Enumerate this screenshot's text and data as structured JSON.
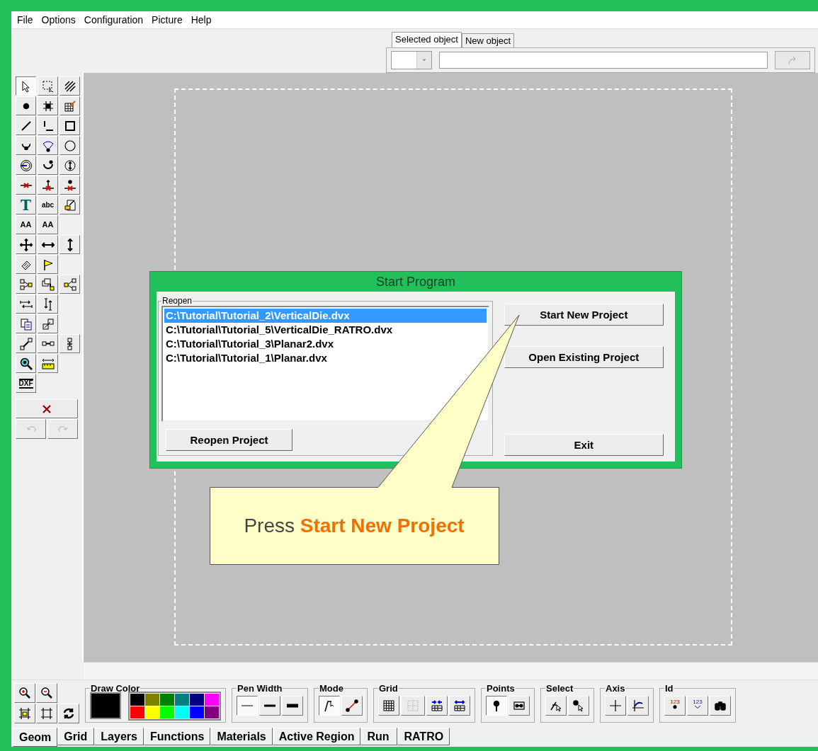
{
  "menu": [
    "File",
    "Options",
    "Configuration",
    "Picture",
    "Help"
  ],
  "object_tabs": [
    {
      "label": "Selected object",
      "selected": true
    },
    {
      "label": "New object",
      "selected": false
    }
  ],
  "palette_rows": [
    {
      "tools": [
        {
          "selected": true
        },
        {
          "selected": false
        },
        {
          "selected": false
        }
      ]
    },
    {
      "tools": [
        {
          "selected": false
        },
        {
          "selected": false
        },
        {
          "selected": false
        }
      ]
    },
    {
      "tools": [
        {
          "selected": false
        },
        {
          "selected": false
        },
        {
          "selected": false
        }
      ]
    },
    {
      "tools": [
        {
          "selected": false
        },
        {
          "selected": false
        },
        {
          "selected": false
        }
      ]
    },
    {
      "tools": [
        {
          "selected": false
        },
        {
          "selected": false
        },
        {
          "selected": false
        }
      ]
    },
    {
      "tools": [
        {
          "selected": false
        },
        {
          "selected": false
        },
        {
          "selected": false
        }
      ]
    },
    {
      "tools": [
        {
          "selected": false,
          "label": "T"
        },
        {
          "selected": false,
          "label": "abc"
        },
        {
          "selected": false
        }
      ]
    },
    {
      "tools": [
        {
          "selected": false,
          "label": "AA"
        },
        {
          "selected": false,
          "label": "AA"
        }
      ]
    },
    {
      "tools": [
        {
          "selected": false
        },
        {
          "selected": false
        },
        {
          "selected": false
        }
      ]
    },
    {
      "tools": [
        {
          "selected": false
        },
        {
          "selected": false
        }
      ]
    },
    {
      "tools": [
        {
          "selected": false
        },
        {
          "selected": false
        },
        {
          "selected": false
        }
      ]
    },
    {
      "tools": [
        {
          "selected": false
        },
        {
          "selected": false
        }
      ]
    },
    {
      "tools": [
        {
          "selected": false
        },
        {
          "selected": false
        }
      ]
    },
    {
      "tools": [
        {
          "selected": false
        },
        {
          "selected": false
        },
        {
          "selected": false
        }
      ]
    },
    {
      "tools": [
        {
          "selected": false
        },
        {
          "selected": false
        }
      ]
    },
    {
      "tools": [
        {
          "selected": false,
          "label": "DXF"
        }
      ]
    }
  ],
  "history_buttons": [
    {
      "disabled": true
    },
    {
      "disabled": true
    }
  ],
  "dialog": {
    "title": "Start Program",
    "group_label": "Reopen",
    "recent_files": [
      {
        "path": "C:\\Tutorial\\Tutorial_2\\VerticalDie.dvx",
        "selected": true
      },
      {
        "path": "C:\\Tutorial\\Tutorial_5\\VerticalDie_RATRO.dvx",
        "selected": false
      },
      {
        "path": "C:\\Tutorial\\Tutorial_3\\Planar2.dvx",
        "selected": false
      },
      {
        "path": "C:\\Tutorial\\Tutorial_1\\Planar.dvx",
        "selected": false
      }
    ],
    "reopen_button": "Reopen Project",
    "start_button": "Start New Project",
    "open_button": "Open Existing Project",
    "exit_button": "Exit"
  },
  "callout": "Press **Start New Project**",
  "draw_color": {
    "label": "Draw Color",
    "current": {
      "color": "#000000"
    },
    "palette": [
      {
        "color": "#000000"
      },
      {
        "color": "#808000"
      },
      {
        "color": "#008000"
      },
      {
        "color": "#008080"
      },
      {
        "color": "#000080"
      },
      {
        "color": "#ff00ff"
      },
      {
        "color": "#ff0000"
      },
      {
        "color": "#ffff00"
      },
      {
        "color": "#00ff00"
      },
      {
        "color": "#00ffff"
      },
      {
        "color": "#0000ff"
      },
      {
        "color": "#800080"
      }
    ]
  },
  "tool_groups": [
    {
      "label": "Pen Width",
      "buttons": [
        {
          "selected": true
        },
        {
          "selected": false
        },
        {
          "selected": false
        }
      ]
    },
    {
      "label": "Mode",
      "buttons": [
        {
          "selected": true
        },
        {
          "selected": false
        }
      ]
    },
    {
      "label": "Grid",
      "buttons": [
        {
          "disabled": false
        },
        {
          "disabled": true
        },
        {
          "disabled": false
        },
        {
          "disabled": false
        }
      ]
    },
    {
      "label": "Points",
      "buttons": [
        {
          "selected": true
        },
        {
          "selected": false
        }
      ]
    },
    {
      "label": "Select",
      "buttons": [
        {
          "selected": false
        },
        {
          "selected": false
        }
      ]
    },
    {
      "label": "Axis",
      "buttons": [
        {
          "selected": false
        },
        {
          "selected": false
        }
      ]
    },
    {
      "label": "Id",
      "buttons": [
        {
          "label": "123",
          "selected": false
        },
        {
          "label": "123",
          "selected": false
        },
        {
          "selected": false
        }
      ]
    }
  ],
  "bottom_tabs": [
    {
      "label": "Geom",
      "selected": true
    },
    {
      "label": "Grid",
      "selected": false
    },
    {
      "label": "Layers",
      "selected": false
    },
    {
      "label": "Functions",
      "selected": false
    },
    {
      "label": "Materials",
      "selected": false
    },
    {
      "label": "Active Region",
      "selected": false
    },
    {
      "label": "Run",
      "selected": false
    },
    {
      "label": "RATRO",
      "selected": false
    }
  ]
}
